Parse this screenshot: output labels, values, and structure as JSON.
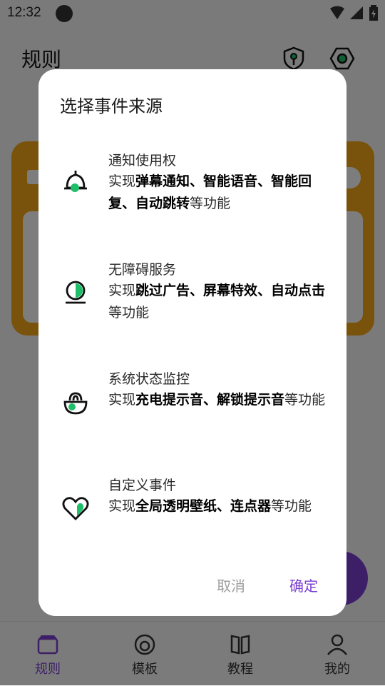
{
  "status_bar": {
    "time": "12:32"
  },
  "app": {
    "title": "规则"
  },
  "nav": {
    "items": [
      {
        "label": "规则",
        "icon": "rules-icon",
        "active": true
      },
      {
        "label": "模板",
        "icon": "template-icon",
        "active": false
      },
      {
        "label": "教程",
        "icon": "tutorial-icon",
        "active": false
      },
      {
        "label": "我的",
        "icon": "profile-icon",
        "active": false
      }
    ]
  },
  "dialog": {
    "title": "选择事件来源",
    "options": [
      {
        "name": "通知使用权",
        "icon": "bell-icon",
        "desc_prefix": "实现",
        "desc_bold": "弹幕通知、智能语音、智能回复、自动跳转",
        "desc_suffix": "等功能"
      },
      {
        "name": "无障碍服务",
        "icon": "accessibility-icon",
        "desc_prefix": "实现",
        "desc_bold": "跳过广告、屏幕特效、自动点击",
        "desc_suffix": "等功能"
      },
      {
        "name": "系统状态监控",
        "icon": "system-monitor-icon",
        "desc_prefix": "实现",
        "desc_bold": "充电提示音、解锁提示音",
        "desc_suffix": "等功能"
      },
      {
        "name": "自定义事件",
        "icon": "heart-icon",
        "desc_prefix": "实现",
        "desc_bold": "全局透明壁纸、连点器",
        "desc_suffix": "等功能"
      }
    ],
    "cancel_label": "取消",
    "confirm_label": "确定"
  },
  "colors": {
    "accent": "#7a3fd0",
    "icon_green": "#1fbf6a",
    "card_orange": "#f2a716"
  }
}
